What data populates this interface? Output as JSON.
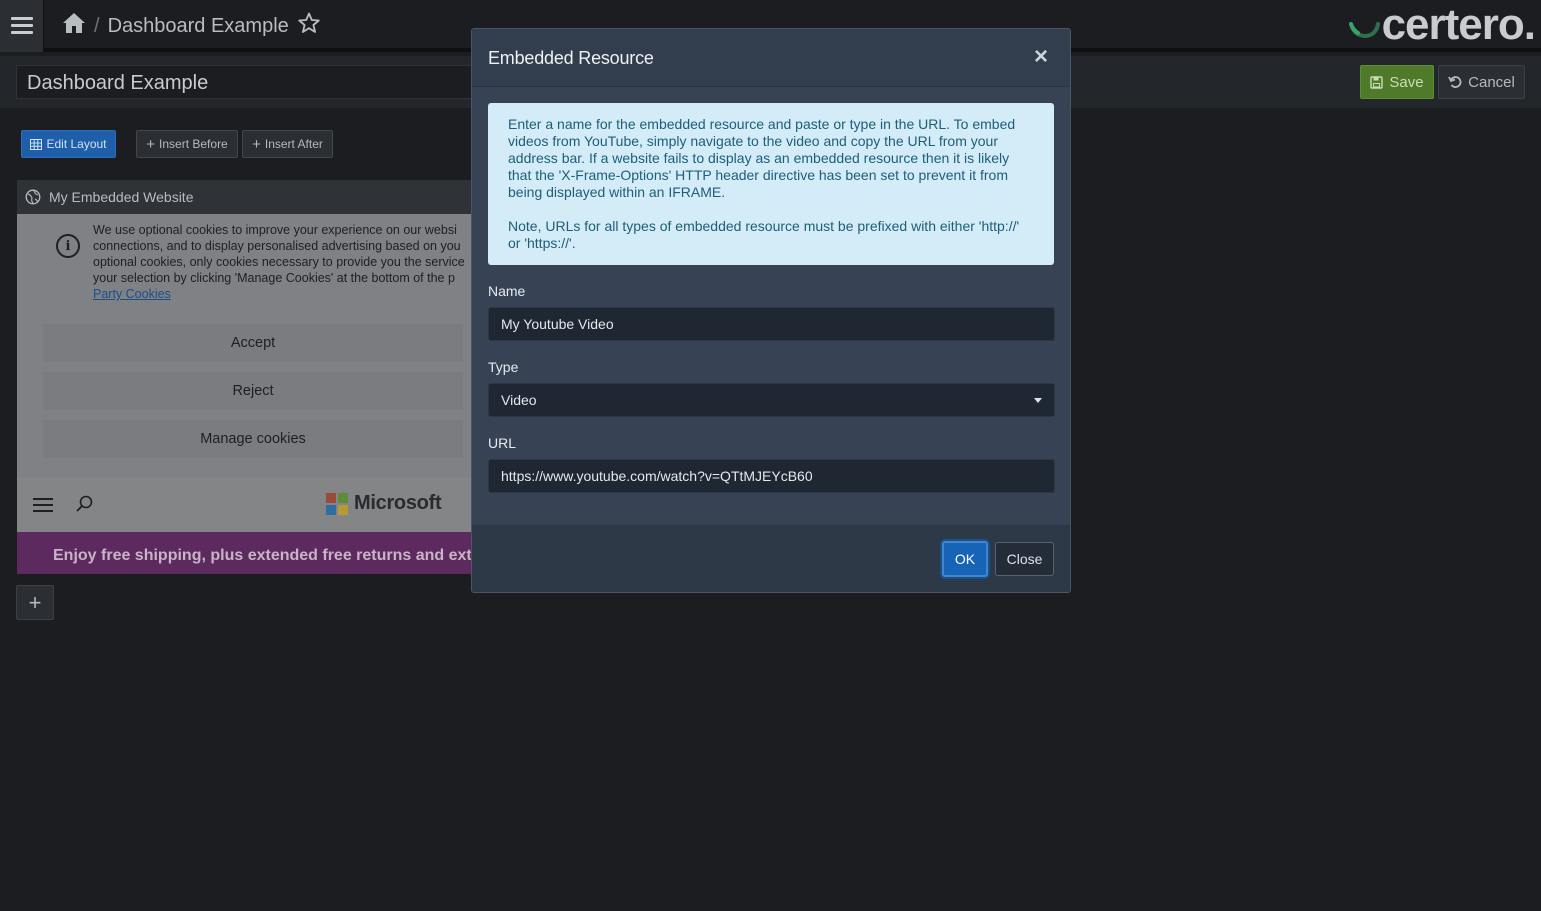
{
  "header": {
    "breadcrumb_page": "Dashboard Example",
    "breadcrumb_separator": "/",
    "brand": "certero."
  },
  "titlebar": {
    "dashboard_title": "Dashboard Example",
    "save_label": "Save",
    "cancel_label": "Cancel"
  },
  "toolbar": {
    "edit_layout_label": "Edit Layout",
    "insert_before_label": "Insert Before",
    "insert_after_label": "Insert After"
  },
  "widget": {
    "title": "My Embedded Website",
    "cookie_lines": [
      "We use optional cookies to improve your experience on our websi",
      "connections, and to display personalised advertising based on you",
      "optional cookies, only cookies necessary to provide you the service",
      "your selection by clicking 'Manage Cookies' at the bottom of the p"
    ],
    "cookie_link": "Party Cookies",
    "accept_label": "Accept",
    "reject_label": "Reject",
    "manage_label": "Manage cookies",
    "ms_brand": "Microsoft",
    "promo_text": "Enjoy free shipping, plus extended free returns and extend"
  },
  "add_widget_label": "+",
  "modal": {
    "title": "Embedded Resource",
    "close_glyph": "×",
    "alert_paragraph_1": "Enter a name for the embedded resource and paste or type in the URL. To embed videos from YouTube, simply navigate to the video and copy the URL from your address bar. If a website fails to display as an embedded resource then it is likely that the 'X-Frame-Options' HTTP header directive has been set to prevent it from being displayed within an IFRAME.",
    "alert_paragraph_2": "Note, URLs for all types of embedded resource must be prefixed with either 'http://' or 'https://'.",
    "name_label": "Name",
    "name_value": "My Youtube Video",
    "type_label": "Type",
    "type_value": "Video",
    "url_label": "URL",
    "url_value": "https://www.youtube.com/watch?v=QTtMJEYcB60",
    "ok_label": "OK",
    "close_label": "Close"
  },
  "colors": {
    "save_green": "#4f7a2a",
    "primary_blue": "#1763b6",
    "alert_bg": "#d4ecf7",
    "modal_bg": "#374354"
  }
}
